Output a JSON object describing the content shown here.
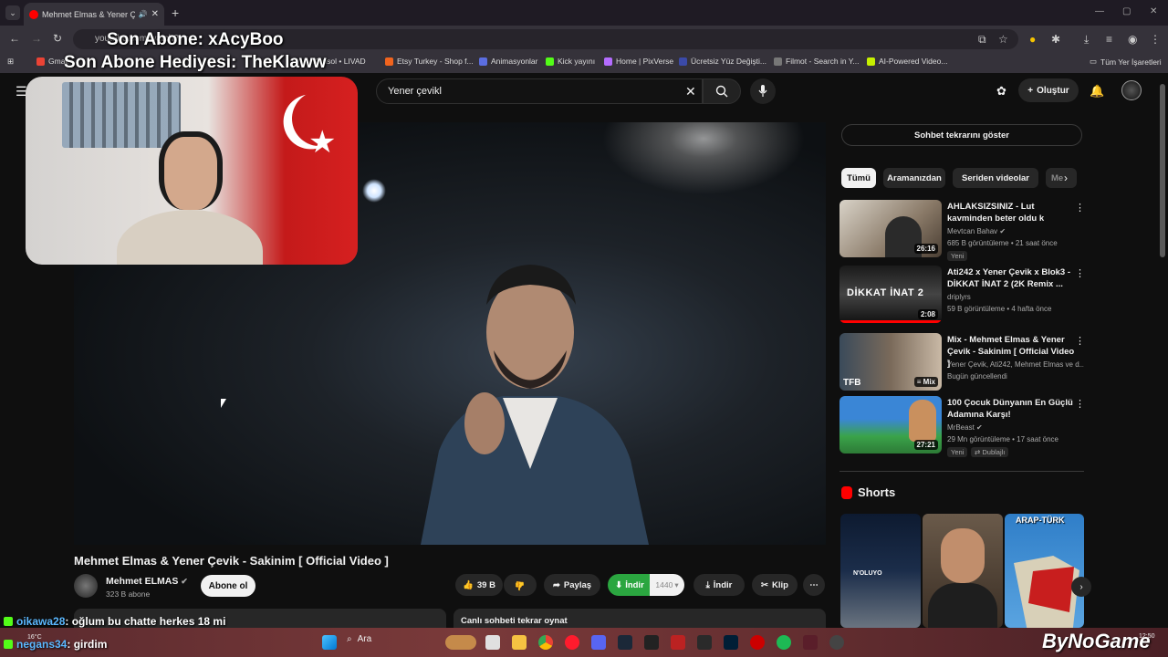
{
  "browser": {
    "tab_title": "Mehmet Elmas & Yener Çevik",
    "url": "youtube.com/watch?v=...",
    "bookmarks": [
      {
        "label": "Gmail",
        "color": "#ea4335"
      },
      {
        "label": "Konsol • LIVAD",
        "color": "#7a5cff"
      },
      {
        "label": "Etsy Turkey - Shop f...",
        "color": "#f1641e"
      },
      {
        "label": "Animasyonlar",
        "color": "#5b6ee1"
      },
      {
        "label": "Kick yayını",
        "color": "#53fc18"
      },
      {
        "label": "Home | PixVerse",
        "color": "#b46cff"
      },
      {
        "label": "Ücretsiz Yüz Değişti...",
        "color": "#1f2a44"
      },
      {
        "label": "Filmot - Search in Y...",
        "color": "#333333"
      },
      {
        "label": "AI-Powered Video...",
        "color": "#c7f000"
      }
    ],
    "all_bookmarks": "Tüm Yer İşaretleri"
  },
  "stream_overlay": {
    "last_sub": "Son Abone: xAcyBoo",
    "last_gift": "Son Abone Hediyesi: TheKlaww"
  },
  "masthead": {
    "search_value": "Yener çevikl",
    "create_label": "Oluştur"
  },
  "video": {
    "title": "Mehmet Elmas & Yener Çevik - Sakinim [ Official Video ]",
    "channel": "Mehmet ELMAS",
    "subscribers": "323 B abone",
    "subscribe_label": "Abone ol",
    "likes": "39 B",
    "share_label": "Paylaş",
    "download_green_label": "İndir",
    "download_quality": "1440",
    "download_label": "İndir",
    "clip_label": "Klip",
    "replay_label": "Canlı sohbeti tekrar oynat"
  },
  "sidebar": {
    "chat_replay": "Sohbet tekrarını göster",
    "chips": [
      "Tümü",
      "Aramanızdan",
      "Seriden videolar",
      "Me"
    ],
    "recommendations": [
      {
        "title": "AHLAKSIZSINIZ - Lut kavminden beter oldu k",
        "channel": "Mevtcan Bahav",
        "meta": "685 B görüntüleme • 21 saat önce",
        "badge": "Yeni",
        "duration": "26:16"
      },
      {
        "title": "Ati242 x Yener Çevik x Blok3 - DİKKAT İNAT 2 (2K Remix ...",
        "channel": "driplyrs",
        "meta": "59 B görüntüleme • 4 hafta önce",
        "badge": "",
        "duration": "2:08",
        "thumb_text": "DİKKAT İNAT 2"
      },
      {
        "title": "Mix - Mehmet Elmas & Yener Çevik - Sakinim [ Official Video ]",
        "channel": "Yener Çevik, Ati242, Mehmet Elmas ve d...",
        "meta": "Bugün güncellendi",
        "badge": "",
        "duration": "Mix",
        "thumb_text": "TFB"
      },
      {
        "title": "100 Çocuk Dünyanın En Güçlü Adamına Karşı!",
        "channel": "MrBeast",
        "meta": "29 Mn görüntüleme • 17 saat önce",
        "badge": "Yeni",
        "badge2": "Dublajlı",
        "duration": "27:21"
      }
    ],
    "shorts_title": "Shorts",
    "shorts": [
      {
        "caption": "N'OLUYO",
        "color": "#1b2d4a"
      },
      {
        "caption": "",
        "color": "#5a4a3a"
      },
      {
        "caption": "ARAP-TÜRK",
        "color": "#3a8fd0"
      }
    ]
  },
  "chat": [
    {
      "user": "oikawa28",
      "message": ": oğlum bu chatte herkes 18 mi"
    },
    {
      "user": "negans34",
      "message": ": girdim"
    }
  ],
  "taskbar": {
    "search_label": "Ara",
    "weather": "16°C",
    "time": "12:50",
    "brand": "ByNoGame"
  }
}
